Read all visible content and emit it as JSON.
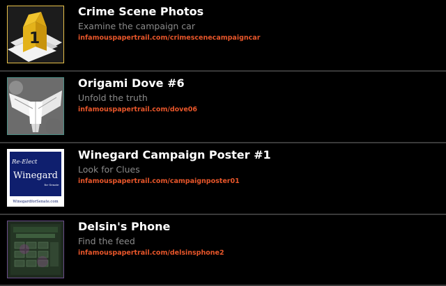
{
  "items": [
    {
      "title": "Crime Scene Photos",
      "subtitle": "Examine the campaign car",
      "url": "infamouspapertrail.com/crimescenecampaigncar",
      "thumb_border": "#e9c24a",
      "thumb_marker_text": "1"
    },
    {
      "title": "Origami Dove #6",
      "subtitle": "Unfold the truth",
      "url": "infamouspapertrail.com/dove06",
      "thumb_border": "#4a8f86"
    },
    {
      "title": "Winegard Campaign Poster #1",
      "subtitle": "Look for Clues",
      "url": "infamouspapertrail.com/campaignposter01",
      "thumb_border": "#ffffff",
      "poster": {
        "tagline": "Re-Elect",
        "name": "Winegard",
        "office": "for Senate",
        "site": "WinegardforSenate.com"
      }
    },
    {
      "title": "Delsin's Phone",
      "subtitle": "Find the feed",
      "url": "infamouspapertrail.com/delsinsphone2",
      "thumb_border": "#6b4e8c"
    }
  ],
  "colors": {
    "background": "#000000",
    "title": "#ffffff",
    "subtitle": "#8a8a8a",
    "url": "#e8562a",
    "divider": "#3a3a3a"
  }
}
